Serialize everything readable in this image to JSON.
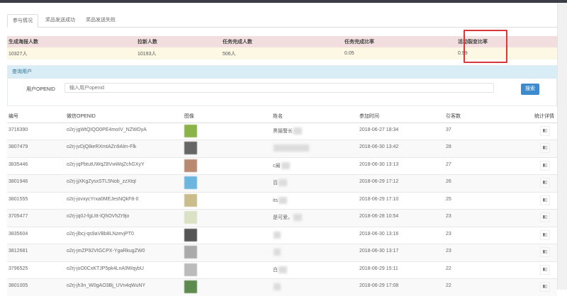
{
  "tabs": [
    "参与情况",
    "奖品发送成功",
    "奖品发送失败"
  ],
  "stats": {
    "headers": [
      "生成海报人数",
      "拉新人数",
      "任务完成人数",
      "任务完成比率",
      "活动裂变比率"
    ],
    "values": [
      "10327人",
      "10193人",
      "506人",
      "0.05",
      "0.99"
    ]
  },
  "search": {
    "panel_title": "查询用户",
    "label": "用户OPENID",
    "placeholder": "输入用户openid",
    "button": "搜索"
  },
  "table": {
    "headers": [
      "编号",
      "微信OPENID",
      "图像",
      "姓名",
      "参加时间",
      "引客数",
      "统计详情"
    ],
    "rows": [
      {
        "id": "3716390",
        "openid": "o2rj-jgWtQIQO0PE4moIV_NZWDyA",
        "name": "黑猫警长",
        "time": "2018-06-27 18:34",
        "count": "37",
        "color": "#8ab34a"
      },
      {
        "id": "3807479",
        "openid": "o2rj-jvDjQ8ieRXmtAZn9Alm-Flk",
        "name": "",
        "time": "2018-06-30 13:42",
        "count": "28",
        "color": "#666"
      },
      {
        "id": "3835446",
        "openid": "o2rj-jqPbtutUWqZ8VwWqZchGXyY",
        "name": "c阑",
        "time": "2018-06-30 13:13",
        "count": "27",
        "color": "#b88a70"
      },
      {
        "id": "3801946",
        "openid": "o2rj-jjXKgZysxSTL5Nob_zzXtqI",
        "name": "百",
        "time": "2018-06-29 17:12",
        "count": "26",
        "color": "#6cb5df"
      },
      {
        "id": "3801555",
        "openid": "o2rj-jovxycYrxa0MEJesNQkF8-0",
        "name": "its",
        "time": "2018-06-29 17:10",
        "count": "25",
        "color": "#c9bd8c"
      },
      {
        "id": "3705477",
        "openid": "o2rj-jq0J-fgLItt-IQhOVhZr9jo",
        "name": "是可爱。",
        "time": "2018-06-28 10:54",
        "count": "23",
        "color": "#d9e2c4"
      },
      {
        "id": "3835604",
        "openid": "o2rj-jlbcj-qs9aVBb8LNzevjPT0",
        "name": "",
        "time": "2018-06-30 13:16",
        "count": "23",
        "color": "#555"
      },
      {
        "id": "3812681",
        "openid": "o2rj-jmZP92VIGCPX-YgaRkugZW0",
        "name": "",
        "time": "2018-06-30 13:17",
        "count": "23",
        "color": "#aaa"
      },
      {
        "id": "3796525",
        "openid": "o2rj-joO0CxKTJP5pk4LnA9WqybU",
        "name": "白",
        "time": "2018-06-29 15:11",
        "count": "22",
        "color": "#bbb"
      },
      {
        "id": "3801005",
        "openid": "o2rj-jh3n_W0gAO3Bj_UVn4qWuNY",
        "name": "",
        "time": "2018-06-29 17:08",
        "count": "22",
        "color": "#5e8a4e"
      }
    ],
    "detail_icon": "bar-chart-icon"
  },
  "colors": {
    "highlight": "#d9383a",
    "button": "#3d8bcd"
  }
}
